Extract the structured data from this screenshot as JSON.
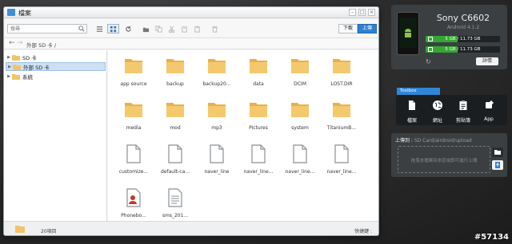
{
  "window": {
    "title": "檔案",
    "controls": [
      "–",
      "□",
      "×"
    ]
  },
  "toolbar": {
    "search_placeholder": "搜尋",
    "download_label": "下載",
    "upload_label": "上傳",
    "icons": [
      "list-view-icon",
      "grid-view-icon",
      "refresh-icon",
      "new-folder-icon",
      "copy-icon",
      "cut-icon",
      "duplicate-icon",
      "paste-icon",
      "delete-icon"
    ]
  },
  "pathbar": {
    "back": "←",
    "forward": "→",
    "path": "外部 SD 卡 /"
  },
  "sidebar": {
    "items": [
      {
        "label": "SD 卡",
        "selected": false
      },
      {
        "label": "外部 SD 卡",
        "selected": true
      },
      {
        "label": "系統",
        "selected": false
      }
    ]
  },
  "files": [
    {
      "name": "app source",
      "type": "folder"
    },
    {
      "name": "backup",
      "type": "folder"
    },
    {
      "name": "backup20...",
      "type": "folder"
    },
    {
      "name": "data",
      "type": "folder"
    },
    {
      "name": "DCIM",
      "type": "folder"
    },
    {
      "name": "LOST.DIR",
      "type": "folder"
    },
    {
      "name": "media",
      "type": "folder"
    },
    {
      "name": "mod",
      "type": "folder"
    },
    {
      "name": "mp3",
      "type": "folder"
    },
    {
      "name": "Pictures",
      "type": "folder"
    },
    {
      "name": "system",
      "type": "folder"
    },
    {
      "name": "TitaniumB...",
      "type": "folder"
    },
    {
      "name": "customize...",
      "type": "file"
    },
    {
      "name": "default-ca...",
      "type": "file"
    },
    {
      "name": "naver_line",
      "type": "file"
    },
    {
      "name": "naver_line...",
      "type": "file"
    },
    {
      "name": "naver_line...",
      "type": "file"
    },
    {
      "name": "naver_line...",
      "type": "file"
    },
    {
      "name": "Phonebo...",
      "type": "contact"
    },
    {
      "name": "sms_201...",
      "type": "text"
    }
  ],
  "status": {
    "count": "20項目",
    "shortcut": "快捷鍵 :"
  },
  "device": {
    "name": "Sony C6602",
    "os": "Android 4.1.2",
    "storage": [
      {
        "label": "5 GB / 11.73 GB",
        "fill_fraction": 0.43
      },
      {
        "label": "5 GB / 11.73 GB",
        "fill_fraction": 0.43
      }
    ],
    "details_label": "詳情"
  },
  "toolbox": {
    "tab_label": "Toolbox",
    "tools": [
      {
        "label": "檔案",
        "icon": "file-icon"
      },
      {
        "label": "網址",
        "icon": "globe-icon"
      },
      {
        "label": "剪貼簿",
        "icon": "clipboard-icon"
      },
      {
        "label": "App",
        "icon": "app-icon"
      }
    ]
  },
  "upload_panel": {
    "label": "上傳到 : ",
    "path": "SD Card/airdroid/upload",
    "hint": "拖曳本檔案到本區域即可進行上傳"
  },
  "watermark": "#57134",
  "colors": {
    "accent": "#2d7fd3",
    "folder": "#f0c46a",
    "storage_fill": "#37a534",
    "panel": "#3b3f42"
  }
}
